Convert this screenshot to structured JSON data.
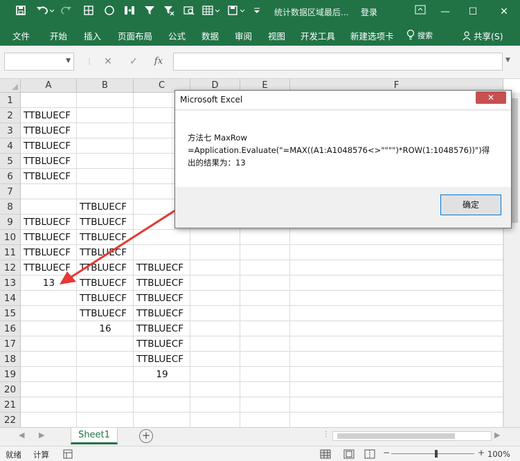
{
  "titlebar": {
    "title": "统计数据区域最后...",
    "login": "登录",
    "minimize_glyph": "—",
    "restore_glyph": "☐",
    "close_glyph": "✕"
  },
  "ribbon": {
    "tabs": [
      "文件",
      "开始",
      "插入",
      "页面布局",
      "公式",
      "数据",
      "审阅",
      "视图",
      "开发工具",
      "新建选项卡"
    ],
    "search": "搜索",
    "share": "共享(S)"
  },
  "formula_bar": {
    "name_box": "",
    "formula": "",
    "cancel_glyph": "✕",
    "enter_glyph": "✓",
    "fx_label": "fx"
  },
  "grid": {
    "columns": [
      "A",
      "B",
      "C",
      "D",
      "E",
      "F"
    ],
    "rows": [
      "1",
      "2",
      "3",
      "4",
      "5",
      "6",
      "7",
      "8",
      "9",
      "10",
      "11",
      "12",
      "13",
      "14",
      "15",
      "16",
      "17",
      "18",
      "19",
      "20",
      "21",
      "22"
    ],
    "col_a": [
      "",
      "TTBLUECF",
      "TTBLUECF",
      "TTBLUECF",
      "TTBLUECF",
      "TTBLUECF",
      "",
      "",
      "TTBLUECF",
      "TTBLUECF",
      "TTBLUECF",
      "TTBLUECF",
      "13",
      "",
      "",
      "",
      "",
      "",
      "",
      "",
      "",
      ""
    ],
    "col_b": [
      "",
      "",
      "",
      "",
      "",
      "",
      "",
      "TTBLUECF",
      "TTBLUECF",
      "TTBLUECF",
      "TTBLUECF",
      "TTBLUECF",
      "TTBLUECF",
      "TTBLUECF",
      "TTBLUECF",
      "16",
      "",
      "",
      "",
      "",
      "",
      ""
    ],
    "col_c": [
      "",
      "",
      "",
      "",
      "",
      "",
      "",
      "",
      "",
      "",
      "",
      "TTBLUECF",
      "TTBLUECF",
      "TTBLUECF",
      "TTBLUECF",
      "TTBLUECF",
      "TTBLUECF",
      "TTBLUECF",
      "19",
      "",
      "",
      ""
    ]
  },
  "sheets": {
    "active": "Sheet1"
  },
  "status": {
    "ready": "就绪",
    "calc": "计算",
    "zoom": "100%"
  },
  "dialog": {
    "title": "Microsoft Excel",
    "close_glyph": "✕",
    "line1": "方法七  MaxRow",
    "line2": "=Application.Evaluate(\"=MAX((A1:A1048576<>\"\"\"\")*ROW(1:1048576))\")得",
    "line3": "出的结果为：13",
    "ok": "确定"
  },
  "colors": {
    "accent": "#217346",
    "arrow": "#e53935"
  }
}
